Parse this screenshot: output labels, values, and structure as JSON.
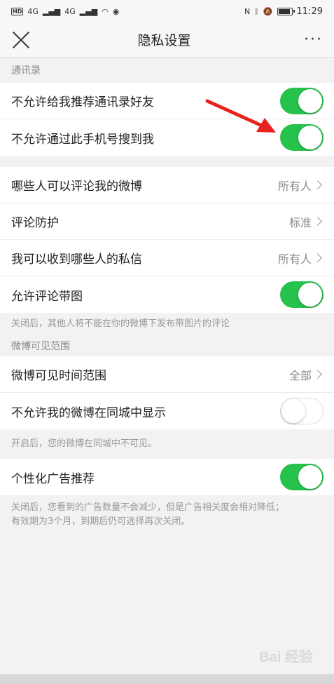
{
  "status": {
    "time": "11:29",
    "hd": "HD",
    "net1": "4G",
    "net2": "4G"
  },
  "nav": {
    "title": "隐私设置",
    "more": "···"
  },
  "contacts": {
    "section": "通讯录",
    "rows": [
      {
        "label": "不允许给我推荐通讯录好友",
        "on": true
      },
      {
        "label": "不允许通过此手机号搜到我",
        "on": true
      }
    ]
  },
  "comments": {
    "rows": [
      {
        "label": "哪些人可以评论我的微博",
        "value": "所有人"
      },
      {
        "label": "评论防护",
        "value": "标准"
      },
      {
        "label": "我可以收到哪些人的私信",
        "value": "所有人"
      }
    ],
    "toggle_row": {
      "label": "允许评论带图",
      "on": true
    },
    "note": "关闭后，其他人将不能在你的微博下发布带图片的评论"
  },
  "visibility": {
    "section": "微博可见范围",
    "time_range": {
      "label": "微博可见时间范围",
      "value": "全部"
    },
    "city": {
      "label": "不允许我的微博在同城中显示",
      "on": false
    },
    "note": "开启后，您的微博在同城中不可见。"
  },
  "ads": {
    "row": {
      "label": "个性化广告推荐",
      "on": true
    },
    "note_line1": "关闭后，您看到的广告数量不会减少，但是广告相关度会相对降低；",
    "note_line2": "有效期为3个月，到期后仍可选择再次关闭。"
  },
  "battery_level": 0.8,
  "colors": {
    "toggle_on": "#27c24c",
    "arrow": "#e8231f"
  },
  "watermark": "Bai 经验"
}
